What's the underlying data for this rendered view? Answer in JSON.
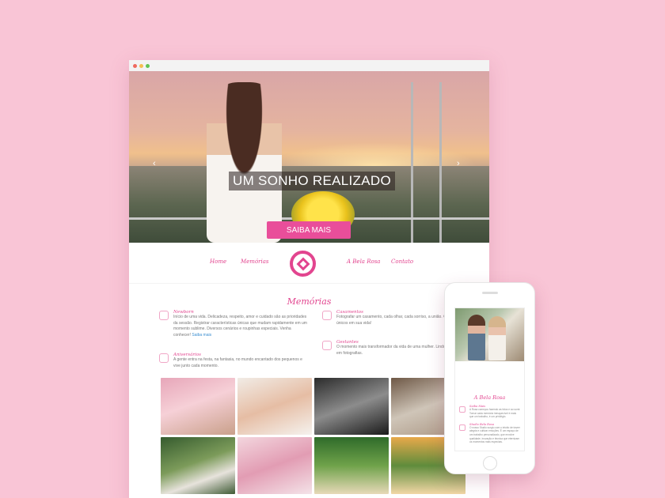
{
  "hero": {
    "title": "UM SONHO REALIZADO",
    "button": "SAIBA MAIS",
    "prev_arrow": "‹",
    "next_arrow": "›"
  },
  "nav": {
    "items": [
      "Home",
      "Memórias",
      "A Bela Rosa",
      "Contato"
    ]
  },
  "memorias": {
    "title": "Memórias",
    "features": [
      {
        "title": "Newborn",
        "text": "Início de uma vida. Delicadeza, respeito, amor e cuidado são as prioridades da sessão. Registrar características únicas que mudam rapidamente em um momento sublime. Diversos cenários e roupinhas especiais. Venha conhecer!",
        "link": "Saiba mais"
      },
      {
        "title": "Casamentos",
        "text": "Fotografar um casamento, cada olhar, cada sorriso, a união. Os momentos únicos em sua vida!",
        "link": ""
      },
      {
        "title": "Aniversários",
        "text": "A gente entra na festa, na fantasia, no mundo encantado dos pequenos e vive junto cada momento.",
        "link": ""
      },
      {
        "title": "Gestantes",
        "text": "O momento mais transformador da vida de uma mulher. Lindo e eternizado em fotografias.",
        "link": ""
      }
    ]
  },
  "phone": {
    "section_title": "A Bela Rosa",
    "features": [
      {
        "title": "Saiba Mais",
        "text": "A Rosa começou fazendo as fotos e ao sorrir. Tornar cada memória inesquecível é mais que um trabalho, é um privilégio."
      },
      {
        "title": "Studio Bela Rosa",
        "text": "O nosso Studio surgiu com o intuito de trazer alegria e cultivar emoções. É um espaço de um trabalho personalizado, que envolve qualidade, inovação e técnica que eternizam os momentos mais especiais."
      }
    ]
  },
  "colors": {
    "background": "#f9c5d6",
    "accent": "#e2458f",
    "button": "#e94e9a"
  },
  "icons": {
    "logo": "bela-rosa-logo-icon",
    "newborn": "baby-icon",
    "casamentos": "rings-icon",
    "aniversarios": "gift-icon",
    "gestantes": "pregnant-icon"
  }
}
